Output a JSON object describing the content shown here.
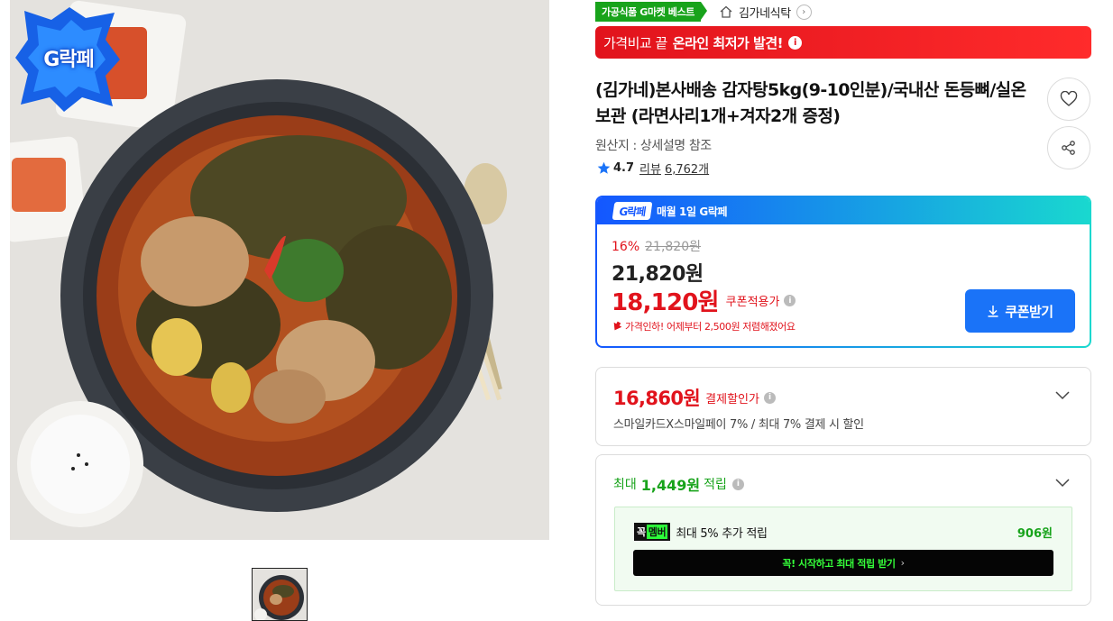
{
  "badges": {
    "gmarket_best": "가공식품 G마켓 베스트",
    "grak_image_badge": "G락페"
  },
  "store": {
    "name": "김가네식탁",
    "arrow": "›"
  },
  "promo_banner": {
    "prefix": "가격비교 끝",
    "strong": "온라인 최저가 발견!",
    "info": "i"
  },
  "product": {
    "title": "(김가네)본사배송 감자탕5kg(9-10인분)/국내산 돈등뼈/실온보관 (라면사리1개+겨자2개 증정)",
    "origin": "원산지 : 상세설명 참조",
    "rating": "4.7",
    "review_label": "리뷰",
    "review_count": "6,762개"
  },
  "grak": {
    "logo": "G락페",
    "header_text": "매월 1일 G락페",
    "discount_rate": "16%",
    "original_price": "21,820원",
    "price": "21,820원",
    "coupon_price": "18,120원",
    "coupon_label": "쿠폰적용가",
    "price_down_note": "가격인하! 어제부터 2,500원 저렴해졌어요",
    "coupon_button": "쿠폰받기"
  },
  "payment": {
    "price": "16,860원",
    "label": "결제할인가",
    "description": "스마일카드X스마일페이 7% / 최대 7% 결제 시 할인"
  },
  "points": {
    "prefix": "최대",
    "amount": "1,449원",
    "suffix": "적립",
    "member_badge_left": "꼭",
    "member_badge_right": "멤버",
    "member_text": "최대 5% 추가 적립",
    "member_amount": "906원",
    "member_button": "꼭! 시작하고 최대 적립 받기",
    "member_button_arrow": "›"
  },
  "colors": {
    "accent_red": "#e1131c",
    "accent_blue": "#1a73f8",
    "accent_green": "#18a31b"
  }
}
